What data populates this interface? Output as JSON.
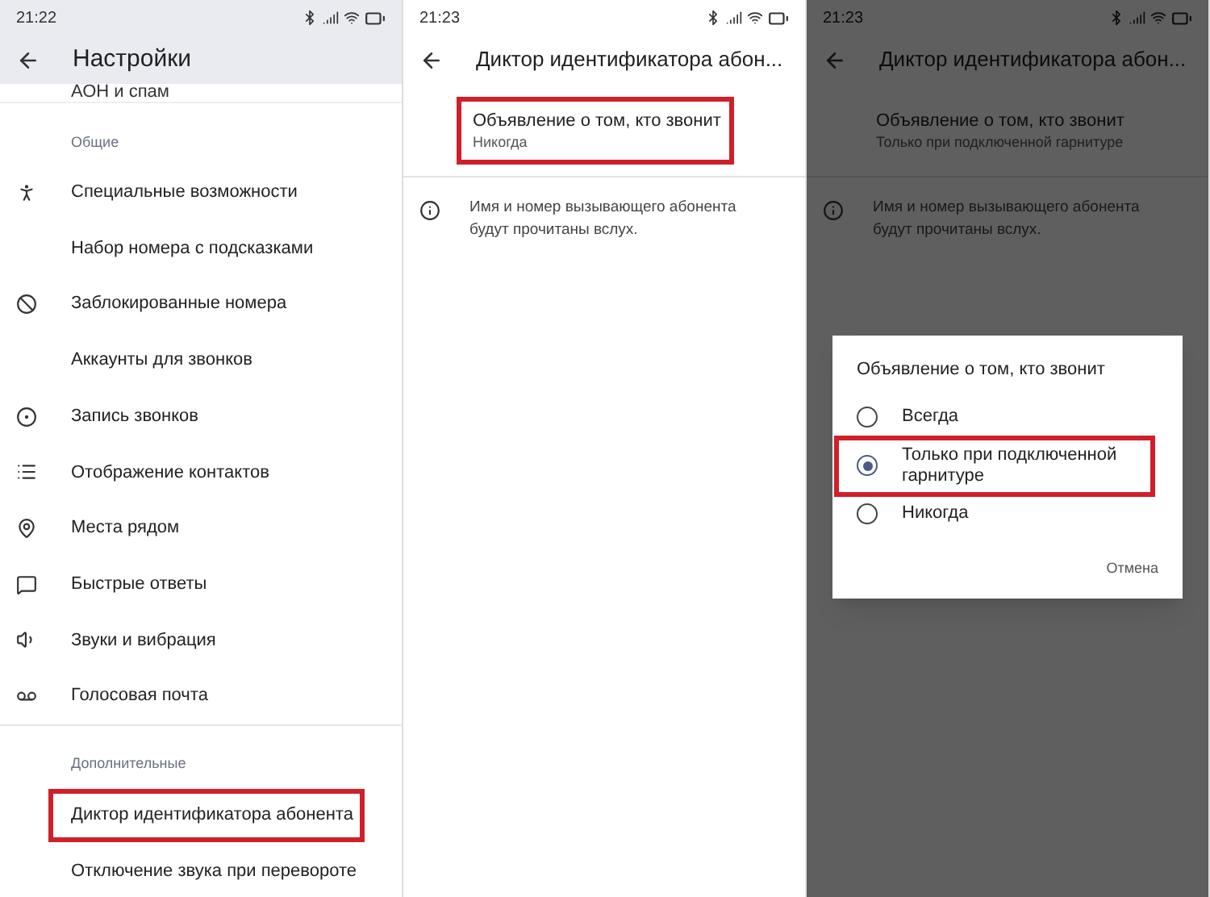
{
  "settings_screen": {
    "time": "21:22",
    "title": "Настройки",
    "partial_item": "АОН и спам",
    "groups": [
      {
        "header": "Общие",
        "items": [
          {
            "label": "Специальные возможности",
            "highlighted": false
          },
          {
            "label": "Набор номера с подсказками",
            "highlighted": false
          },
          {
            "label": "Заблокированные номера",
            "highlighted": false
          },
          {
            "label": "Аккаунты для звонков",
            "highlighted": false
          },
          {
            "label": "Запись звонков",
            "highlighted": false
          },
          {
            "label": "Отображение контактов",
            "highlighted": false
          },
          {
            "label": "Места рядом",
            "highlighted": false
          },
          {
            "label": "Быстрые ответы",
            "highlighted": false
          },
          {
            "label": "Звуки и вибрация",
            "highlighted": false
          },
          {
            "label": "Голосовая почта",
            "highlighted": false
          }
        ]
      },
      {
        "header": "Дополнительные",
        "items": [
          {
            "label": "Диктор идентификатора абонента",
            "highlighted": true
          },
          {
            "label": "Отключение звука при перевороте",
            "highlighted": false
          }
        ]
      }
    ]
  },
  "caller_id_screens": [
    {
      "time": "21:23",
      "title": "Диктор идентификатора абон...",
      "setting": {
        "label": "Объявление о том, кто звонит",
        "value": "Никогда",
        "highlighted": true
      },
      "info": "Имя и номер вызывающего абонента будут прочитаны вслух.",
      "dimmed": false
    },
    {
      "time": "21:23",
      "title": "Диктор идентификатора абон...",
      "setting": {
        "label": "Объявление о том, кто звонит",
        "value": "Только при подключенной гарнитуре",
        "highlighted": false
      },
      "info": "Имя и номер вызывающего абонента будут прочитаны вслух.",
      "dimmed": true,
      "dialog": {
        "title": "Объявление о том, кто звонит",
        "options": [
          {
            "label": "Всегда",
            "selected": false,
            "highlighted": false
          },
          {
            "label": "Только при подключенной гарнитуре",
            "selected": true,
            "highlighted": true
          },
          {
            "label": "Никогда",
            "selected": false,
            "highlighted": false
          }
        ],
        "cancel": "Отмена"
      }
    }
  ]
}
